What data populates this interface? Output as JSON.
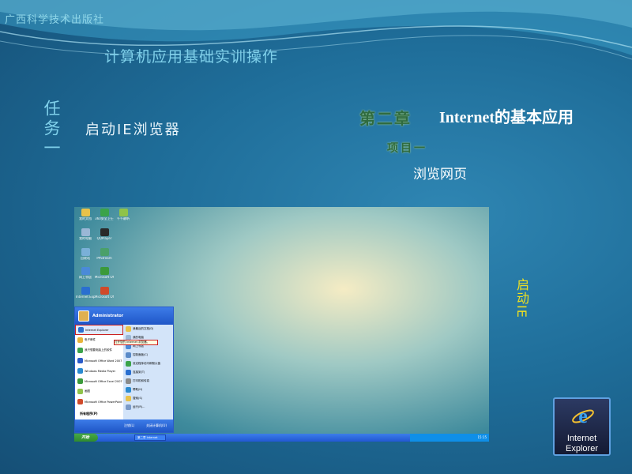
{
  "publisher": "广西科学技术出版社",
  "course_title": "计算机应用基础实训操作",
  "task_label": "任务一",
  "task_text": "启动IE浏览器",
  "chapter": {
    "number": "第二章",
    "title": "Internet的基本应用"
  },
  "project_label": "项目一",
  "project_title": "浏览网页",
  "launch_note": "启动IE",
  "screenshot": {
    "user": "Administrator",
    "start_label": "开始",
    "all_programs": "所有程序(P)",
    "tooltip": "打开您的 Internet 浏览器。",
    "taskbar_task": "第二章 Internet",
    "clock": "15:15",
    "start_menu_left": [
      "Internet Explorer",
      "电子邮件",
      "我只想要电脑上的软件",
      "Microsoft Office Word 2007",
      "Windows Media Player",
      "Microsoft Office Excel 2007",
      "画图",
      "Microsoft Office PowerPoint 2007"
    ],
    "start_menu_right": [
      "我最近的文档(D)",
      "我的电脑",
      "网上邻居",
      "控制面板(C)",
      "设定程序访问和默认值",
      "连接到(T)",
      "打印机和传真",
      "帮助(H)",
      "搜索(S)",
      "运行(R)..."
    ],
    "logoff": "注销(L)",
    "shutdown": "关闭计算机(U)",
    "desktop_icons": [
      {
        "label": "我的文档",
        "color": "#e8c24a"
      },
      {
        "label": "360安全卫士",
        "color": "#3ba34a"
      },
      {
        "label": "千千静听",
        "color": "#8fc34a"
      },
      {
        "label": "我的电脑",
        "color": "#9ab7d6"
      },
      {
        "label": "QQPlayer",
        "color": "#2a2a2a"
      },
      {
        "label": "回收站",
        "color": "#7ab0d8"
      },
      {
        "label": "PPStream",
        "color": "#4aa06a"
      },
      {
        "label": "网上邻居",
        "color": "#4a8ad8"
      },
      {
        "label": "Microsoft Office",
        "color": "#3b9a3b"
      },
      {
        "label": "Internet Explorer",
        "color": "#2a6fd0"
      },
      {
        "label": "Microsoft Office",
        "color": "#d04a2a"
      }
    ]
  },
  "ie_shortcut": {
    "line1": "Internet",
    "line2": "Explorer",
    "icon": "ie-logo-icon"
  }
}
